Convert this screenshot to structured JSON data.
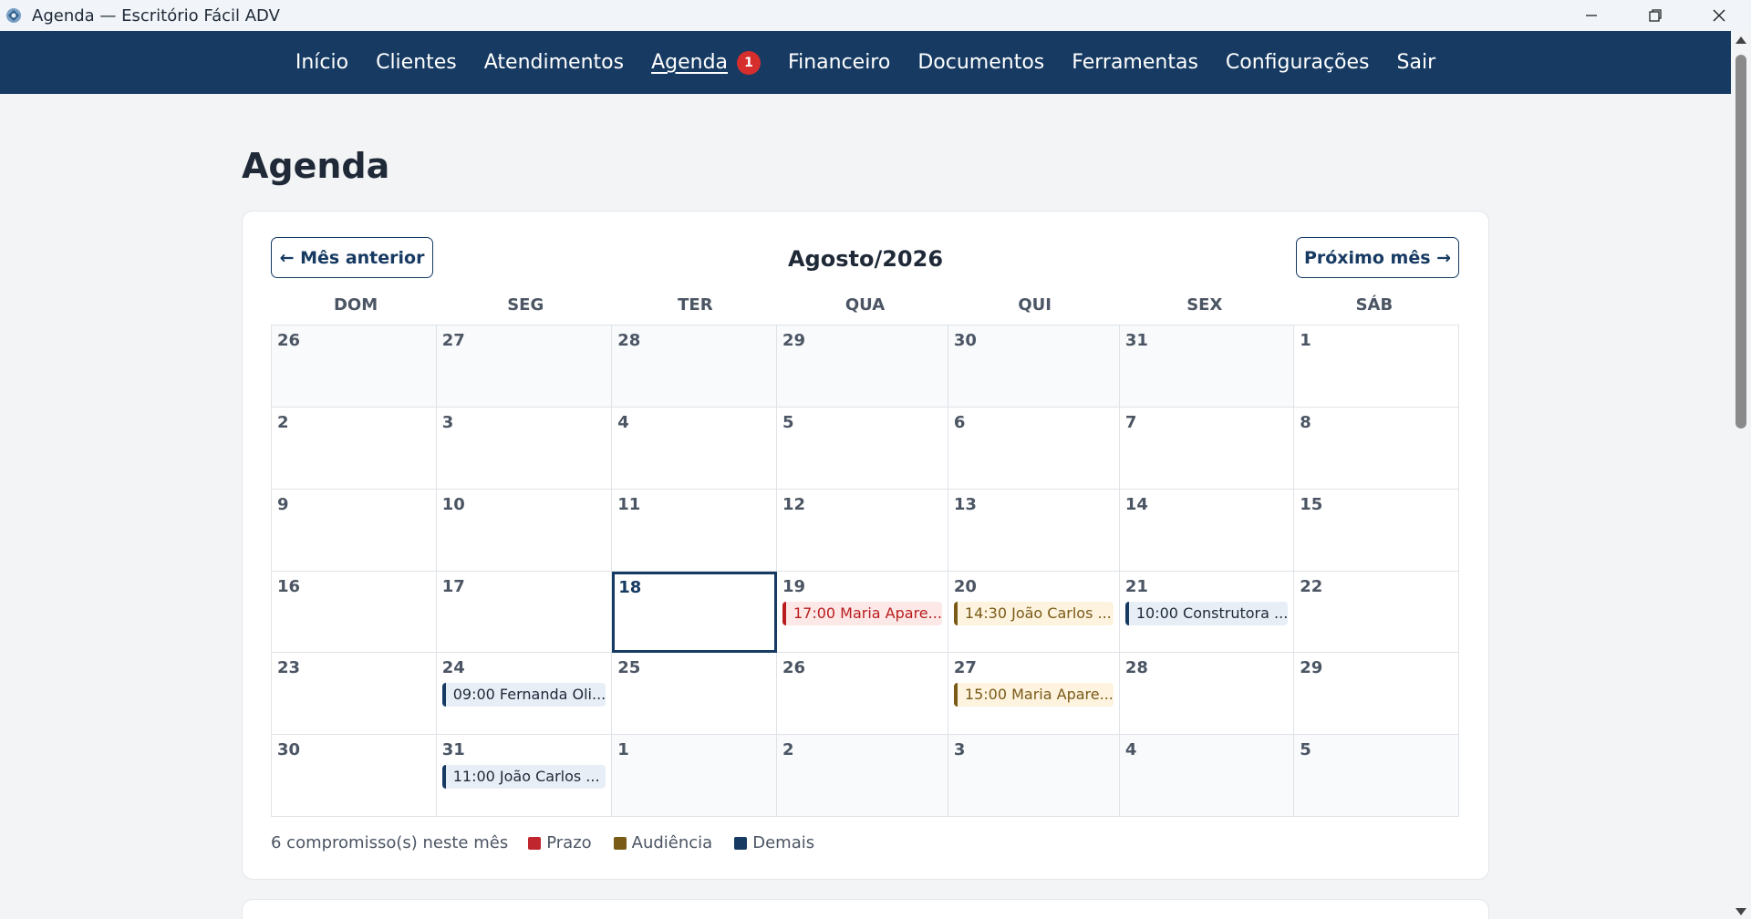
{
  "window": {
    "title": "Agenda — Escritório Fácil ADV"
  },
  "nav": {
    "items": [
      {
        "label": "Início"
      },
      {
        "label": "Clientes"
      },
      {
        "label": "Atendimentos"
      },
      {
        "label": "Agenda",
        "badge": "1",
        "active": true
      },
      {
        "label": "Financeiro"
      },
      {
        "label": "Documentos"
      },
      {
        "label": "Ferramentas"
      },
      {
        "label": "Configurações"
      },
      {
        "label": "Sair"
      }
    ]
  },
  "page": {
    "title": "Agenda"
  },
  "calendar": {
    "prev_label": "← Mês anterior",
    "next_label": "Próximo mês →",
    "month_title": "Agosto/2026",
    "weekdays": [
      "DOM",
      "SEG",
      "TER",
      "QUA",
      "QUI",
      "SEX",
      "SÁB"
    ],
    "days": [
      {
        "d": "26",
        "current": false
      },
      {
        "d": "27",
        "current": false
      },
      {
        "d": "28",
        "current": false
      },
      {
        "d": "29",
        "current": false
      },
      {
        "d": "30",
        "current": false
      },
      {
        "d": "31",
        "current": false
      },
      {
        "d": "1",
        "current": true
      },
      {
        "d": "2",
        "current": true
      },
      {
        "d": "3",
        "current": true
      },
      {
        "d": "4",
        "current": true
      },
      {
        "d": "5",
        "current": true
      },
      {
        "d": "6",
        "current": true
      },
      {
        "d": "7",
        "current": true
      },
      {
        "d": "8",
        "current": true
      },
      {
        "d": "9",
        "current": true
      },
      {
        "d": "10",
        "current": true
      },
      {
        "d": "11",
        "current": true
      },
      {
        "d": "12",
        "current": true
      },
      {
        "d": "13",
        "current": true
      },
      {
        "d": "14",
        "current": true
      },
      {
        "d": "15",
        "current": true
      },
      {
        "d": "16",
        "current": true
      },
      {
        "d": "17",
        "current": true
      },
      {
        "d": "18",
        "current": true,
        "today": true
      },
      {
        "d": "19",
        "current": true,
        "events": [
          {
            "text": "17:00 Maria Apare...",
            "type": "prazo"
          }
        ]
      },
      {
        "d": "20",
        "current": true,
        "events": [
          {
            "text": "14:30 João Carlos ...",
            "type": "audiencia"
          }
        ]
      },
      {
        "d": "21",
        "current": true,
        "events": [
          {
            "text": "10:00 Construtora ...",
            "type": "demais"
          }
        ]
      },
      {
        "d": "22",
        "current": true
      },
      {
        "d": "23",
        "current": true
      },
      {
        "d": "24",
        "current": true,
        "events": [
          {
            "text": "09:00 Fernanda Oli...",
            "type": "demais"
          }
        ]
      },
      {
        "d": "25",
        "current": true
      },
      {
        "d": "26",
        "current": true
      },
      {
        "d": "27",
        "current": true,
        "events": [
          {
            "text": "15:00 Maria Apare...",
            "type": "audiencia"
          }
        ]
      },
      {
        "d": "28",
        "current": true
      },
      {
        "d": "29",
        "current": true
      },
      {
        "d": "30",
        "current": true
      },
      {
        "d": "31",
        "current": true,
        "events": [
          {
            "text": "11:00 João Carlos ...",
            "type": "demais"
          }
        ]
      },
      {
        "d": "1",
        "current": false
      },
      {
        "d": "2",
        "current": false
      },
      {
        "d": "3",
        "current": false
      },
      {
        "d": "4",
        "current": false
      },
      {
        "d": "5",
        "current": false
      }
    ]
  },
  "legend": {
    "count_text": "6 compromisso(s) neste mês",
    "items": [
      {
        "label": "Prazo",
        "color": "#c0262d"
      },
      {
        "label": "Audiência",
        "color": "#7a5a17"
      },
      {
        "label": "Demais",
        "color": "#163a62"
      }
    ]
  },
  "colors": {
    "nav_bg": "#163a62",
    "badge": "#d62d2d",
    "prazo": "#b91c1c",
    "audiencia": "#7a5a17",
    "demais": "#163a62"
  }
}
